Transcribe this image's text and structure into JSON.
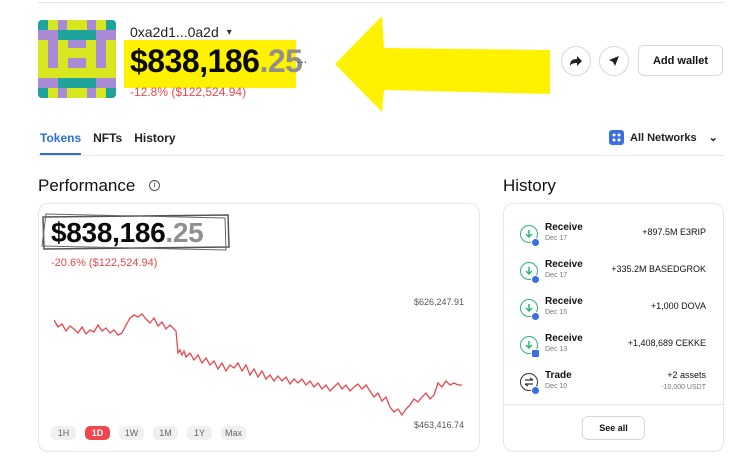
{
  "wallet": {
    "address": "0xa2d1...0a2d",
    "balance_main": "$838,186",
    "balance_cents": ".25",
    "change": "-12.8% ($122,524.94)",
    "more": "..."
  },
  "header_actions": {
    "share_icon": "share-arrow-icon",
    "send_icon": "send-icon",
    "add_wallet_label": "Add wallet"
  },
  "tabs": [
    {
      "label": "Tokens",
      "active": true
    },
    {
      "label": "NFTs",
      "active": false
    },
    {
      "label": "History",
      "active": false
    }
  ],
  "network_selector": {
    "label": "All Networks"
  },
  "performance": {
    "title": "Performance",
    "balance_main": "$838,186",
    "balance_cents": ".25",
    "change": "-20.6% ($122,524.94)",
    "max_label": "$626,247.91",
    "min_label": "$463,416.74",
    "ranges": [
      {
        "label": "1H",
        "active": false
      },
      {
        "label": "1D",
        "active": true
      },
      {
        "label": "1W",
        "active": false
      },
      {
        "label": "1M",
        "active": false
      },
      {
        "label": "1Y",
        "active": false
      },
      {
        "label": "Max",
        "active": false
      }
    ],
    "line_color": "#e5484d"
  },
  "history": {
    "title": "History",
    "items": [
      {
        "type": "Receive",
        "date": "Dec 17",
        "amount": "+897.5M E3RIP"
      },
      {
        "type": "Receive",
        "date": "Dec 17",
        "amount": "+335.2M BASEDGROK"
      },
      {
        "type": "Receive",
        "date": "Dec 15",
        "amount": "+1,000 DOVA"
      },
      {
        "type": "Receive",
        "date": "Dec 13",
        "amount": "+1,408,689 CEKKE"
      },
      {
        "type": "Trade",
        "date": "Dec 10",
        "amount": "+2 assets",
        "sub": "-10,000 USDT"
      }
    ],
    "see_all_label": "See all"
  },
  "colors": {
    "accent": "#2d6fd8",
    "negative": "#e5484d",
    "highlight": "#fff200",
    "receive": "#2bb673"
  }
}
